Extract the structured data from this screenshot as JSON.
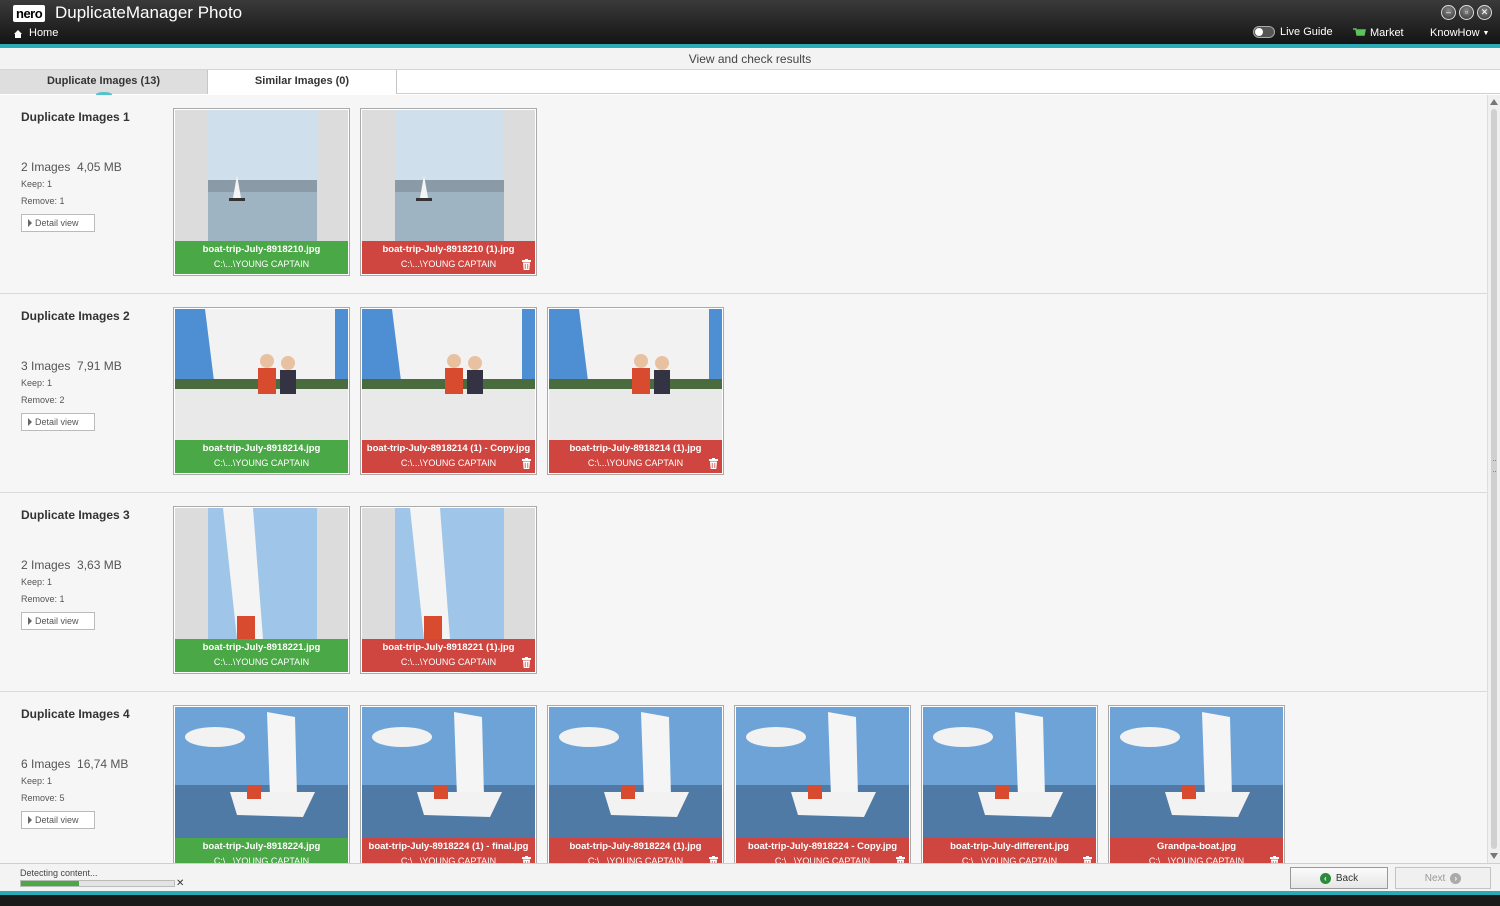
{
  "app": {
    "logo": "nero",
    "title": "DuplicateManager Photo",
    "home_label": "Home",
    "live_guide_label": "Live Guide",
    "market_label": "Market",
    "knowhow_label": "KnowHow",
    "accent_color": "#2aa9b6"
  },
  "subheader": {
    "title": "View and check results"
  },
  "tabs": [
    {
      "label": "Duplicate Images (13)",
      "active": true
    },
    {
      "label": "Similar Images (0)",
      "active": false
    }
  ],
  "groups": [
    {
      "title": "Duplicate Images 1",
      "count": "2 Images",
      "size": "4,05 MB",
      "keep": "Keep: 1",
      "remove": "Remove: 1",
      "detail_label": "Detail view",
      "images": [
        {
          "name": "boat-trip-July-8918210.jpg",
          "path": "C:\\...\\YOUNG CAPTAIN",
          "status": "keep",
          "photo": "lake"
        },
        {
          "name": "boat-trip-July-8918210 (1).jpg",
          "path": "C:\\...\\YOUNG CAPTAIN",
          "status": "remove",
          "photo": "lake"
        }
      ]
    },
    {
      "title": "Duplicate Images 2",
      "count": "3 Images",
      "size": "7,91 MB",
      "keep": "Keep: 1",
      "remove": "Remove: 2",
      "detail_label": "Detail view",
      "images": [
        {
          "name": "boat-trip-July-8918214.jpg",
          "path": "C:\\...\\YOUNG CAPTAIN",
          "status": "keep",
          "photo": "couple"
        },
        {
          "name": "boat-trip-July-8918214 (1) - Copy.jpg",
          "path": "C:\\...\\YOUNG CAPTAIN",
          "status": "remove",
          "photo": "couple"
        },
        {
          "name": "boat-trip-July-8918214 (1).jpg",
          "path": "C:\\...\\YOUNG CAPTAIN",
          "status": "remove",
          "photo": "couple"
        }
      ]
    },
    {
      "title": "Duplicate Images 3",
      "count": "2 Images",
      "size": "3,63 MB",
      "keep": "Keep: 1",
      "remove": "Remove: 1",
      "detail_label": "Detail view",
      "images": [
        {
          "name": "boat-trip-July-8918221.jpg",
          "path": "C:\\...\\YOUNG CAPTAIN",
          "status": "keep",
          "photo": "sail"
        },
        {
          "name": "boat-trip-July-8918221 (1).jpg",
          "path": "C:\\...\\YOUNG CAPTAIN",
          "status": "remove",
          "photo": "sail"
        }
      ]
    },
    {
      "title": "Duplicate Images 4",
      "count": "6 Images",
      "size": "16,74 MB",
      "keep": "Keep: 1",
      "remove": "Remove: 5",
      "detail_label": "Detail view",
      "images": [
        {
          "name": "boat-trip-July-8918224.jpg",
          "path": "C:\\...\\YOUNG CAPTAIN",
          "status": "keep",
          "photo": "sailing"
        },
        {
          "name": "boat-trip-July-8918224 (1) - final.jpg",
          "path": "C:\\...\\YOUNG CAPTAIN",
          "status": "remove",
          "photo": "sailing"
        },
        {
          "name": "boat-trip-July-8918224 (1).jpg",
          "path": "C:\\...\\YOUNG CAPTAIN",
          "status": "remove",
          "photo": "sailing"
        },
        {
          "name": "boat-trip-July-8918224 - Copy.jpg",
          "path": "C:\\...\\YOUNG CAPTAIN",
          "status": "remove",
          "photo": "sailing"
        },
        {
          "name": "boat-trip-July-different.jpg",
          "path": "C:\\...\\YOUNG CAPTAIN",
          "status": "remove",
          "photo": "sailing"
        },
        {
          "name": "Grandpa-boat.jpg",
          "path": "C:\\...\\YOUNG CAPTAIN",
          "status": "remove",
          "photo": "sailing"
        }
      ]
    }
  ],
  "status": {
    "text": "Detecting content...",
    "progress": 0.38
  },
  "buttons": {
    "back_label": "Back",
    "next_label": "Next"
  },
  "colors": {
    "keep": "#4aa846",
    "remove": "#cf4641"
  }
}
